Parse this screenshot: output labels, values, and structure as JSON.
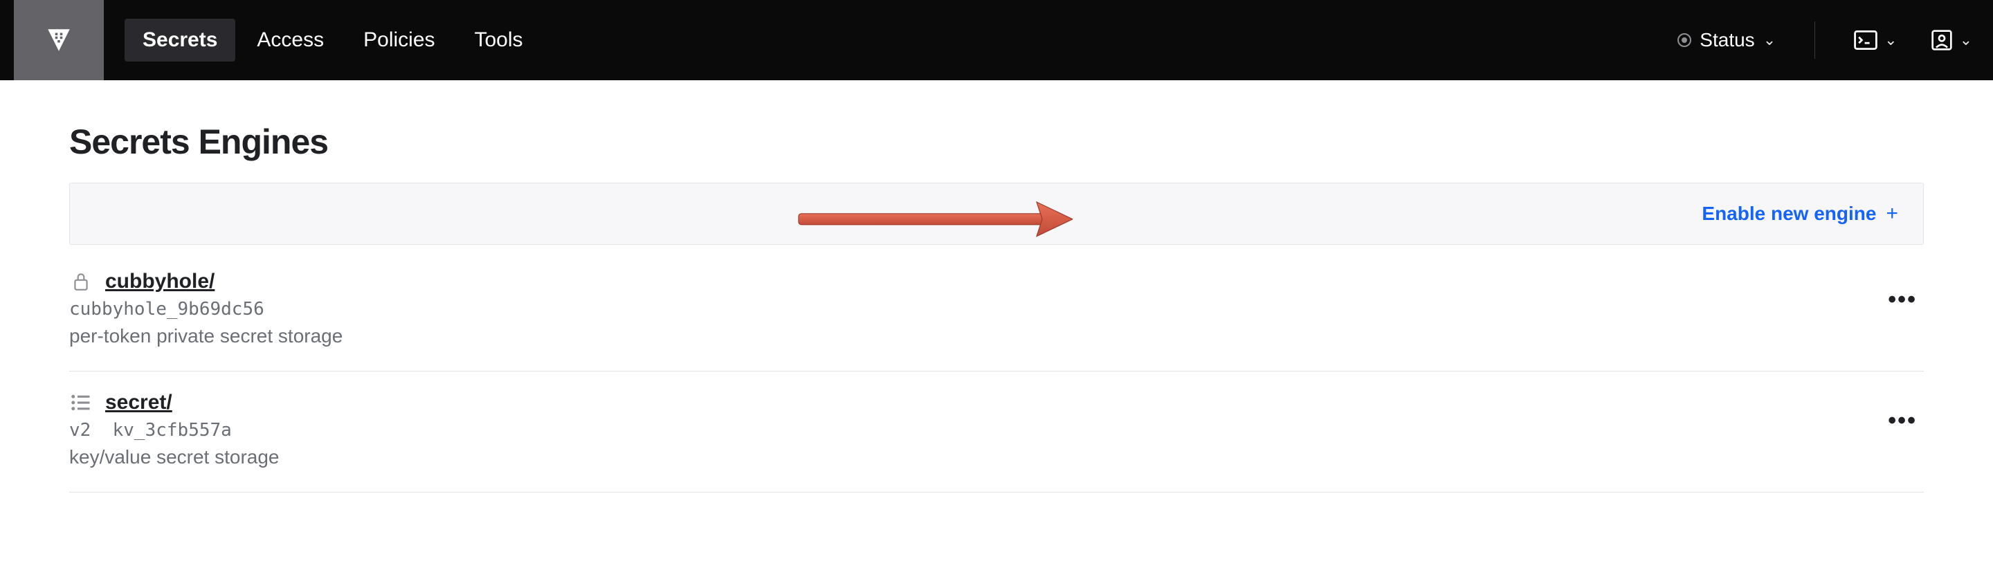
{
  "nav": {
    "items": [
      {
        "label": "Secrets",
        "active": true
      },
      {
        "label": "Access",
        "active": false
      },
      {
        "label": "Policies",
        "active": false
      },
      {
        "label": "Tools",
        "active": false
      }
    ],
    "status_label": "Status"
  },
  "page": {
    "title": "Secrets Engines",
    "enable_button": "Enable new engine"
  },
  "engines": [
    {
      "name": "cubbyhole/",
      "accessor": "cubbyhole_9b69dc56",
      "version": "",
      "description": "per-token private secret storage",
      "icon": "lock"
    },
    {
      "name": "secret/",
      "accessor": "kv_3cfb557a",
      "version": "v2",
      "description": "key/value secret storage",
      "icon": "list"
    }
  ]
}
